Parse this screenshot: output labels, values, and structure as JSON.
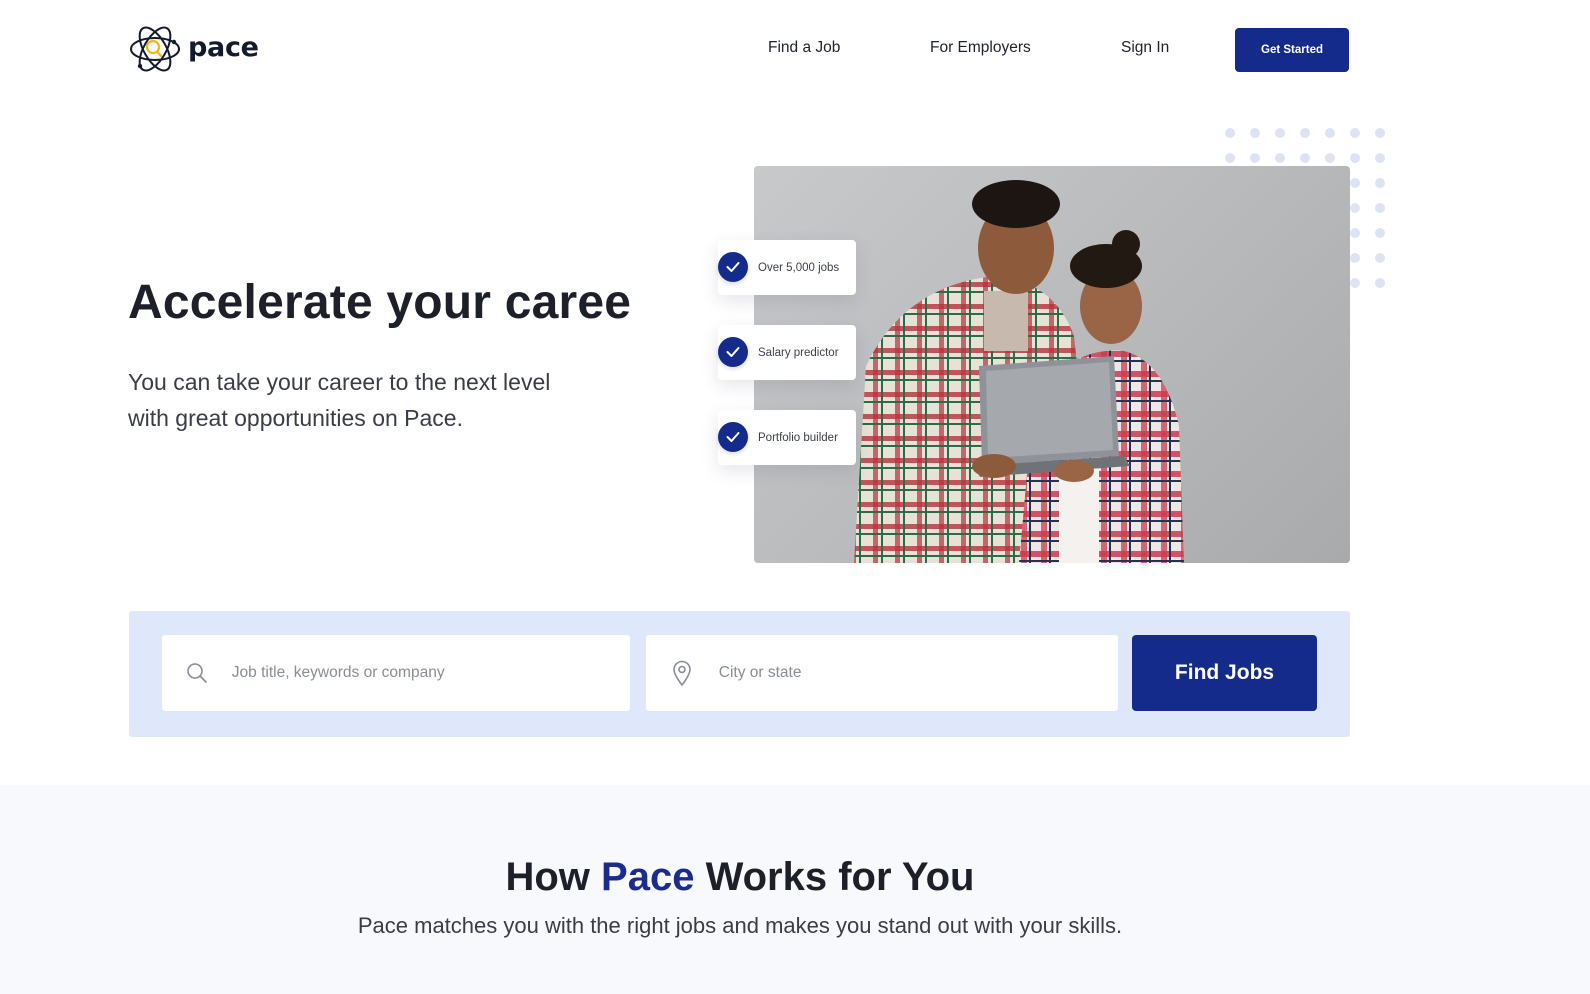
{
  "brand": {
    "name": "pace",
    "accent": "#152b8c",
    "logo_highlight": "#f2b811"
  },
  "nav": {
    "links": [
      "Find a Job",
      "For Employers",
      "Sign In"
    ],
    "cta_label": "Get Started"
  },
  "hero": {
    "title": "Accelerate your caree",
    "subtitle": "You can take your career to the next level with great opportunities on Pace.",
    "features": [
      "Over 5,000 jobs",
      "Salary predictor",
      "Portfolio builder"
    ]
  },
  "search": {
    "keyword_placeholder": "Job title, keywords or company",
    "location_placeholder": "City or state",
    "button_label": "Find Jobs",
    "keyword_icon": "search-icon",
    "location_icon": "map-pin-icon"
  },
  "how": {
    "title_before": "How ",
    "title_accent": "Pace",
    "title_after": " Works for You",
    "subtitle": "Pace matches you with the right jobs and makes you stand out with your skills."
  }
}
